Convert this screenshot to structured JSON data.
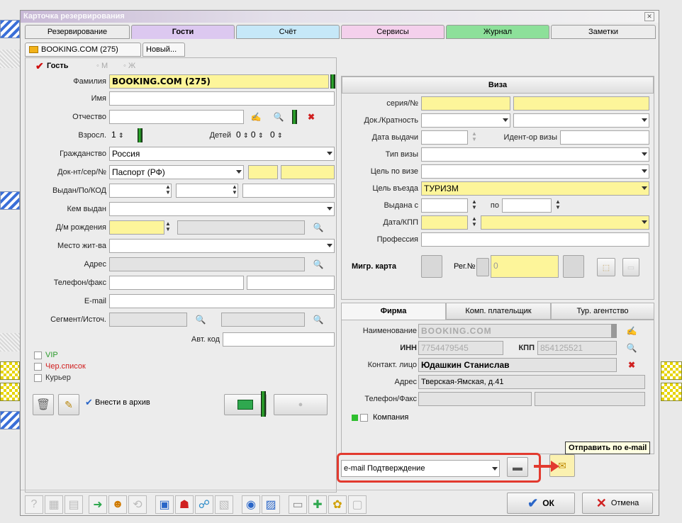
{
  "window": {
    "title": "Карточка резервирования"
  },
  "tabs": [
    {
      "label": "Резервирование",
      "color": "#e8e8e8"
    },
    {
      "label": "Гости",
      "color": "#dcc8f0"
    },
    {
      "label": "Счёт",
      "color": "#c6e8f8"
    },
    {
      "label": "Сервисы",
      "color": "#f4d0ec"
    },
    {
      "label": "Журнал",
      "color": "#8de09a"
    },
    {
      "label": "Заметки",
      "color": "#e8e8e8"
    }
  ],
  "subtabs": [
    "BOOKING.COM (275)",
    "Новый..."
  ],
  "guest": {
    "header": "Гость",
    "gender_m": "М",
    "gender_f": "Ж",
    "surname_label": "Фамилия",
    "surname": "BOOKING.COM (275)",
    "name_label": "Имя",
    "patronymic_label": "Отчество",
    "adults_label": "Взросл.",
    "adults": "1",
    "children_label": "Детей",
    "children_a": "0",
    "children_b": "0",
    "children_c": "0",
    "citizenship_label": "Гражданство",
    "citizenship": "Россия",
    "doc_label": "Док-нт/сер/№",
    "doc": "Паспорт (РФ)",
    "issued_label": "Выдан/По/КОД",
    "issued_by_label": "Кем выдан",
    "birth_label": "Д/м рождения",
    "residence_label": "Место жит-ва",
    "address_label": "Адрес",
    "phone_label": "Телефон/факс",
    "email_label": "E-mail",
    "segment_label": "Сегмент/Источ.",
    "autocode_label": "Авт. код",
    "vip": "VIP",
    "blacklist": "Чер.список",
    "courier": "Курьер",
    "archive": "Внести в архив"
  },
  "visa": {
    "header": "Виза",
    "series_label": "серия/№",
    "doc_mult_label": "Док./Кратность",
    "issue_date_label": "Дата выдачи",
    "visa_id_label": "Идент-ор визы",
    "visa_type_label": "Тип визы",
    "visa_purpose_label": "Цель по визе",
    "entry_purpose_label": "Цель въезда",
    "entry_purpose": "ТУРИЗМ",
    "issued_from_label": "Выдана с",
    "to_label": "по",
    "date_kpp_label": "Дата/КПП",
    "profession_label": "Профессия",
    "migr_card_label": "Мигр. карта",
    "reg_label": "Рег.№",
    "reg_value": "0"
  },
  "company_tabs": [
    "Фирма",
    "Комп. плательщик",
    "Тур. агентство"
  ],
  "company": {
    "name_label": "Наименование",
    "name": "BOOKING.COM",
    "inn_label": "ИНН",
    "inn": "7754479545",
    "kpp_label": "КПП",
    "kpp": "854125521",
    "contact_label": "Контакт. лицо",
    "contact": "Юдашкин Станислав",
    "address_label": "Адрес",
    "address": "Тверская-Ямская, д.41",
    "phone_label": "Телефон/Факс",
    "company_check": "Компания"
  },
  "email_select": "e-mail Подтверждение",
  "tooltip": "Отправить по e-mail",
  "ok_label": "ОК",
  "cancel_label": "Отмена",
  "colors": {
    "highlight": "#e23a2f",
    "yellow_field": "#fdf59a"
  }
}
